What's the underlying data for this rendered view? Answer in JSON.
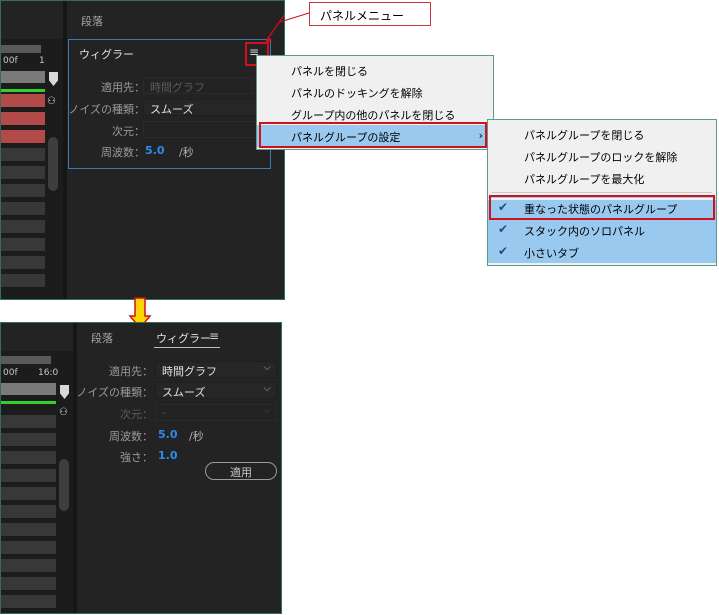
{
  "callout": {
    "label": "パネルメニュー"
  },
  "top_panel": {
    "header_tab": "段落",
    "title": "ウィグラー",
    "menu_icon": "hamburger-icon",
    "time_label": "00f",
    "time_label_2": "1",
    "fields": {
      "apply_to_label": "適用先：",
      "apply_to_value": "時間グラフ",
      "noise_type_label": "ノイズの種類：",
      "noise_type_value": "スムーズ",
      "dimension_label": "次元：",
      "frequency_label": "周波数：",
      "frequency_value": "5.0",
      "frequency_unit": "/秒"
    }
  },
  "panel_menu": {
    "items": [
      {
        "label": "パネルを閉じる"
      },
      {
        "label": "パネルのドッキングを解除"
      },
      {
        "label": "グループ内の他のパネルを閉じる"
      },
      {
        "label": "パネルグループの設定",
        "submenu_arrow": "›"
      }
    ]
  },
  "submenu": {
    "items": [
      {
        "label": "パネルグループを閉じる",
        "checked": false
      },
      {
        "label": "パネルグループのロックを解除",
        "checked": false
      },
      {
        "label": "パネルグループを最大化",
        "checked": false
      },
      {
        "label": "重なった状態のパネルグループ",
        "checked": true
      },
      {
        "label": "スタック内のソロパネル",
        "checked": true
      },
      {
        "label": "小さいタブ",
        "checked": true
      }
    ],
    "check_glyph": "✔"
  },
  "arrow": {
    "color": "#ffd500",
    "border": "#d0101a"
  },
  "bottom_panel": {
    "tabs": [
      {
        "label": "段落"
      },
      {
        "label": "ウィグラー"
      }
    ],
    "menu_glyph": "≡",
    "time_label": "00f",
    "time_label_2": "16:0",
    "fields": {
      "apply_to_label": "適用先：",
      "apply_to_value": "時間グラフ",
      "noise_type_label": "ノイズの種類：",
      "noise_type_value": "スムーズ",
      "dimension_label": "次元：",
      "dimension_value": "-",
      "frequency_label": "周波数：",
      "frequency_value": "5.0",
      "frequency_unit": "/秒",
      "strength_label": "強さ：",
      "strength_value": "1.0"
    },
    "apply_button": "適用"
  },
  "colors": {
    "accent_blue": "#2d8ceb",
    "highlight": "#99c9ef",
    "red": "#d0101a",
    "green_line": "#2fd02f"
  }
}
